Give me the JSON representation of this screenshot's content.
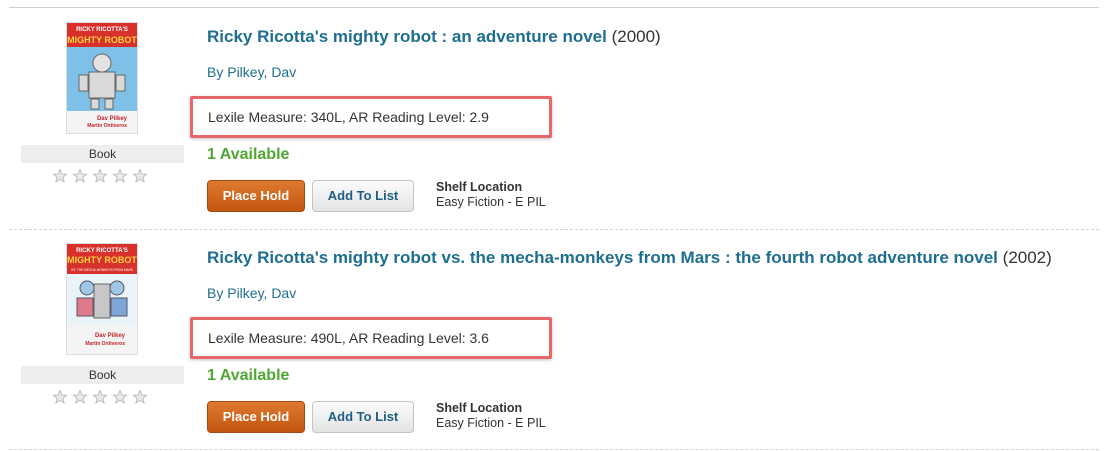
{
  "results": [
    {
      "title": "Ricky Ricotta's mighty robot : an adventure novel",
      "year": "(2000)",
      "author": "By Pilkey, Dav",
      "reading_level": "Lexile Measure: 340L, AR Reading Level: 2.9",
      "availability": "1 Available",
      "format": "Book",
      "rating_stars": 5,
      "place_hold_label": "Place Hold",
      "add_to_list_label": "Add To List",
      "shelf_location_label": "Shelf Location",
      "shelf_location_value": "Easy Fiction - E PIL",
      "cover": {
        "top_text": "RICKY RICOTTA'S",
        "main_text": "MIGHTY ROBOT",
        "author_line1": "Dav Pilkey",
        "author_line2": "Martin Ontiveros"
      }
    },
    {
      "title": "Ricky Ricotta's mighty robot vs. the mecha-monkeys from Mars : the fourth robot adventure novel",
      "year": "(2002)",
      "author": "By Pilkey, Dav",
      "reading_level": "Lexile Measure: 490L, AR Reading Level: 3.6",
      "availability": "1 Available",
      "format": "Book",
      "rating_stars": 5,
      "place_hold_label": "Place Hold",
      "add_to_list_label": "Add To List",
      "shelf_location_label": "Shelf Location",
      "shelf_location_value": "Easy Fiction - E PIL",
      "cover": {
        "top_text": "RICKY RICOTTA'S",
        "main_text": "MIGHTY ROBOT",
        "sub_text": "VS. THE MECHA-MONKEYS FROM MARS",
        "author_line1": "Dav Pilkey",
        "author_line2": "Martin Ontiveros"
      }
    }
  ],
  "colors": {
    "title_link": "#1e6e8f",
    "available": "#4fa830",
    "highlight_border": "#e8676a",
    "place_hold": "#c2560f"
  },
  "icons": {
    "rating": "star-icon"
  }
}
